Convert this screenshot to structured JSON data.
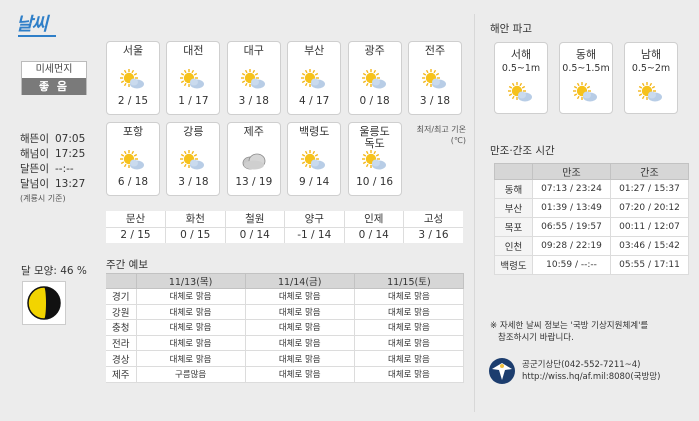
{
  "title": "날씨",
  "dust": {
    "label": "미세먼지",
    "value": "좋 음"
  },
  "sun": {
    "rows": [
      {
        "k": "해뜬이",
        "v": "07:05"
      },
      {
        "k": "해넘이",
        "v": "17:25"
      },
      {
        "k": "달뜬이",
        "v": "--:--"
      },
      {
        "k": "달넘이",
        "v": "13:27"
      }
    ],
    "note": "(계룡시 기준)"
  },
  "moon": {
    "label": "달 모양: 46 %"
  },
  "cities_row1": [
    {
      "name": "서울",
      "temp": "2 / 15",
      "icon": "partly-cloudy-icon"
    },
    {
      "name": "대전",
      "temp": "1 / 17",
      "icon": "partly-cloudy-icon"
    },
    {
      "name": "대구",
      "temp": "3 / 18",
      "icon": "partly-cloudy-icon"
    },
    {
      "name": "부산",
      "temp": "4 / 17",
      "icon": "partly-cloudy-icon"
    },
    {
      "name": "광주",
      "temp": "0 / 18",
      "icon": "partly-cloudy-icon"
    },
    {
      "name": "전주",
      "temp": "3 / 18",
      "icon": "partly-cloudy-icon"
    }
  ],
  "cities_row2": [
    {
      "name": "포항",
      "temp": "6 / 18",
      "icon": "partly-cloudy-icon"
    },
    {
      "name": "강릉",
      "temp": "3 / 18",
      "icon": "partly-cloudy-icon"
    },
    {
      "name": "제주",
      "temp": "13 / 19",
      "icon": "cloudy-icon"
    },
    {
      "name": "백령도",
      "temp": "9 / 14",
      "icon": "partly-cloudy-icon"
    },
    {
      "name": "울릉도\n독도",
      "temp": "10 / 16",
      "icon": "partly-cloudy-icon"
    }
  ],
  "minmax_note": "최저/최고 기온\n(℃)",
  "small_table": {
    "names": [
      "문산",
      "화천",
      "철원",
      "양구",
      "인제",
      "고성"
    ],
    "temps": [
      "2 / 15",
      "0 / 15",
      "0 / 14",
      "-1 / 14",
      "0 / 14",
      "3 / 16"
    ]
  },
  "weekly": {
    "title": "주간 예보",
    "dates": [
      "11/13(목)",
      "11/14(금)",
      "11/15(토)"
    ],
    "rows": [
      {
        "region": "경기",
        "vals": [
          "대체로 맑음",
          "대체로 맑음",
          "대체로 맑음"
        ]
      },
      {
        "region": "강원",
        "vals": [
          "대체로 맑음",
          "대체로 맑음",
          "대체로 맑음"
        ]
      },
      {
        "region": "충청",
        "vals": [
          "대체로 맑음",
          "대체로 맑음",
          "대체로 맑음"
        ]
      },
      {
        "region": "전라",
        "vals": [
          "대체로 맑음",
          "대체로 맑음",
          "대체로 맑음"
        ]
      },
      {
        "region": "경상",
        "vals": [
          "대체로 맑음",
          "대체로 맑음",
          "대체로 맑음"
        ]
      },
      {
        "region": "제주",
        "vals": [
          "구름많음",
          "대체로 맑음",
          "대체로 맑음"
        ]
      }
    ]
  },
  "coast": {
    "title": "해안 파고",
    "items": [
      {
        "name": "서해",
        "range": "0.5~1m"
      },
      {
        "name": "동해",
        "range": "0.5~1.5m"
      },
      {
        "name": "남해",
        "range": "0.5~2m"
      }
    ]
  },
  "tide": {
    "title": "만조·간조 시간",
    "headers": [
      "만조",
      "간조"
    ],
    "rows": [
      {
        "loc": "동해",
        "high": "07:13 / 23:24",
        "low": "01:27 / 15:37"
      },
      {
        "loc": "부산",
        "high": "01:39 / 13:49",
        "low": "07:20 / 20:12"
      },
      {
        "loc": "목포",
        "high": "06:55 / 19:57",
        "low": "00:11 / 12:07"
      },
      {
        "loc": "인천",
        "high": "09:28 / 22:19",
        "low": "03:46 / 15:42"
      },
      {
        "loc": "백령도",
        "high": "10:59 / --:--",
        "low": "05:55 / 17:11"
      }
    ]
  },
  "footer": {
    "note1": "※ 자세한 날씨 정보는 '국방 기상지원체계'를",
    "note2": "참조하시기 바랍니다.",
    "contact1": "공군기상단(042-552-7211~4)",
    "contact2": "http://wiss.hq/af.mil:8080(국방망)"
  },
  "colors": {
    "accent": "#2f7fc8",
    "sun": "#f3b71b",
    "cloud": "#9db7d6",
    "header": "#d6d6d6"
  }
}
